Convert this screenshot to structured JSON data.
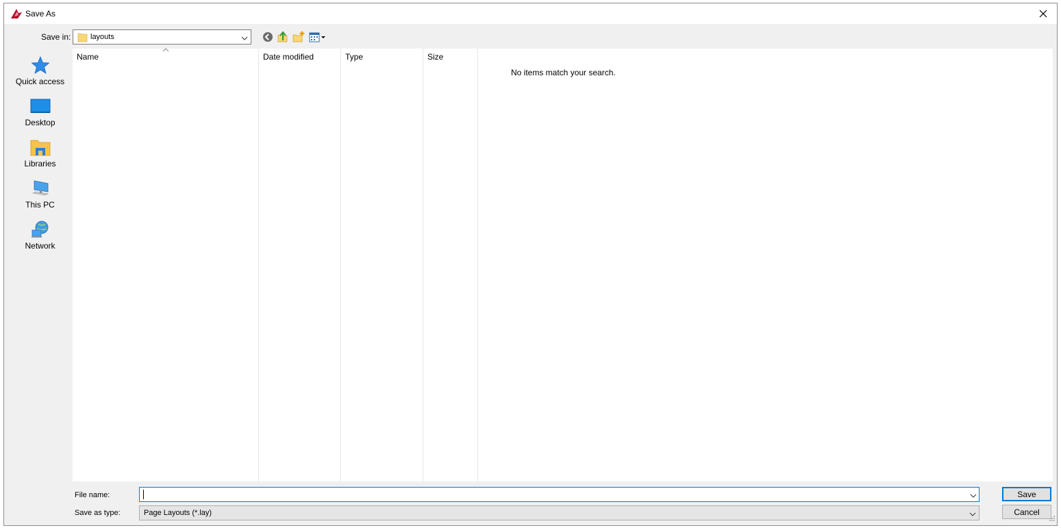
{
  "window": {
    "title": "Save As",
    "close_label": "✕"
  },
  "save_in": {
    "label": "Save in:",
    "value": "layouts"
  },
  "toolbar": {
    "back_icon": "back-icon",
    "up_icon": "up-folder-icon",
    "new_folder_icon": "new-folder-icon",
    "view_menu_icon": "view-menu-icon"
  },
  "places": [
    {
      "label": "Quick access",
      "icon": "star-icon"
    },
    {
      "label": "Desktop",
      "icon": "desktop-icon"
    },
    {
      "label": "Libraries",
      "icon": "libraries-icon"
    },
    {
      "label": "This PC",
      "icon": "computer-icon"
    },
    {
      "label": "Network",
      "icon": "network-icon"
    }
  ],
  "file_list": {
    "columns": [
      "Name",
      "Date modified",
      "Type",
      "Size"
    ],
    "empty_message": "No items match your search."
  },
  "file_name": {
    "label": "File name:",
    "value": ""
  },
  "save_as_type": {
    "label": "Save as type:",
    "value": "Page Layouts (*.lay)"
  },
  "buttons": {
    "save": "Save",
    "cancel": "Cancel"
  },
  "colors": {
    "accent": "#0078d7",
    "dialog_bg": "#f0f0f0",
    "app_icon": "#b5122e"
  }
}
